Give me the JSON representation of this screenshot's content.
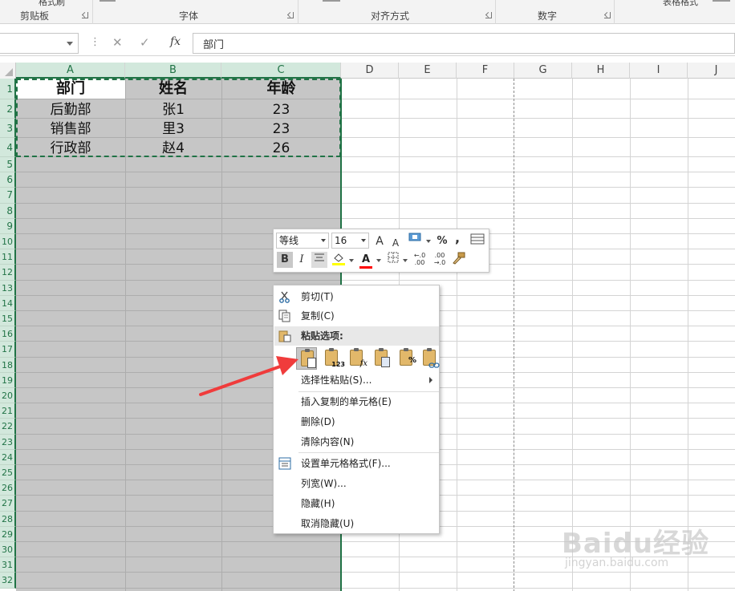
{
  "ribbon": {
    "groups": [
      {
        "label": "剪贴板"
      },
      {
        "label": "字体"
      },
      {
        "label": "对齐方式"
      },
      {
        "label": "数字"
      },
      {
        "label": "表格格式"
      }
    ],
    "top_item": "格式刷"
  },
  "formula_bar": {
    "name_box": "",
    "cancel_icon": "✕",
    "enter_icon": "✓",
    "fx_label": "fx",
    "content": "部门"
  },
  "columns": [
    "A",
    "B",
    "C",
    "D",
    "E",
    "F",
    "G",
    "H",
    "I",
    "J"
  ],
  "rows": [
    "1",
    "2",
    "3",
    "4",
    "5",
    "6",
    "7",
    "8",
    "9",
    "10",
    "11",
    "12",
    "13",
    "14",
    "15",
    "16",
    "17",
    "18",
    "19",
    "20",
    "21",
    "22",
    "23",
    "24",
    "25",
    "26",
    "27",
    "28",
    "29",
    "30",
    "31",
    "32"
  ],
  "sheet": {
    "headers": [
      "部门",
      "姓名",
      "年龄"
    ],
    "data": [
      [
        "后勤部",
        "张1",
        "23"
      ],
      [
        "销售部",
        "里3",
        "23"
      ],
      [
        "行政部",
        "赵4",
        "26"
      ]
    ]
  },
  "mini_toolbar": {
    "font_name": "等线",
    "font_size": "16",
    "grow_font": "A",
    "shrink_font": "A",
    "percent": "%",
    "comma": ",",
    "bold": "B",
    "italic": "I",
    "font_color_letter": "A",
    "increase_decimal": "←.0\n.00",
    "decrease_decimal": ".00\n→.0",
    "fill_color": "#ffff00",
    "font_color": "#ff0000"
  },
  "context_menu": {
    "cut": "剪切(T)",
    "copy": "复制(C)",
    "paste_options_header": "粘贴选项:",
    "paste_values_text": "123",
    "paste_formula_text": "fx",
    "paste_special": "选择性粘贴(S)...",
    "insert_copied": "插入复制的单元格(E)",
    "delete": "删除(D)",
    "clear_contents": "清除内容(N)",
    "format_cells": "设置单元格格式(F)...",
    "column_width": "列宽(W)...",
    "hide": "隐藏(H)",
    "unhide": "取消隐藏(U)"
  },
  "watermark": {
    "brand": "Baidu经验",
    "url": "jingyan.baidu.com"
  },
  "colors": {
    "accent_green": "#217346",
    "selection_gray": "#c6c6c6",
    "arrow_red": "#f03c3c"
  }
}
